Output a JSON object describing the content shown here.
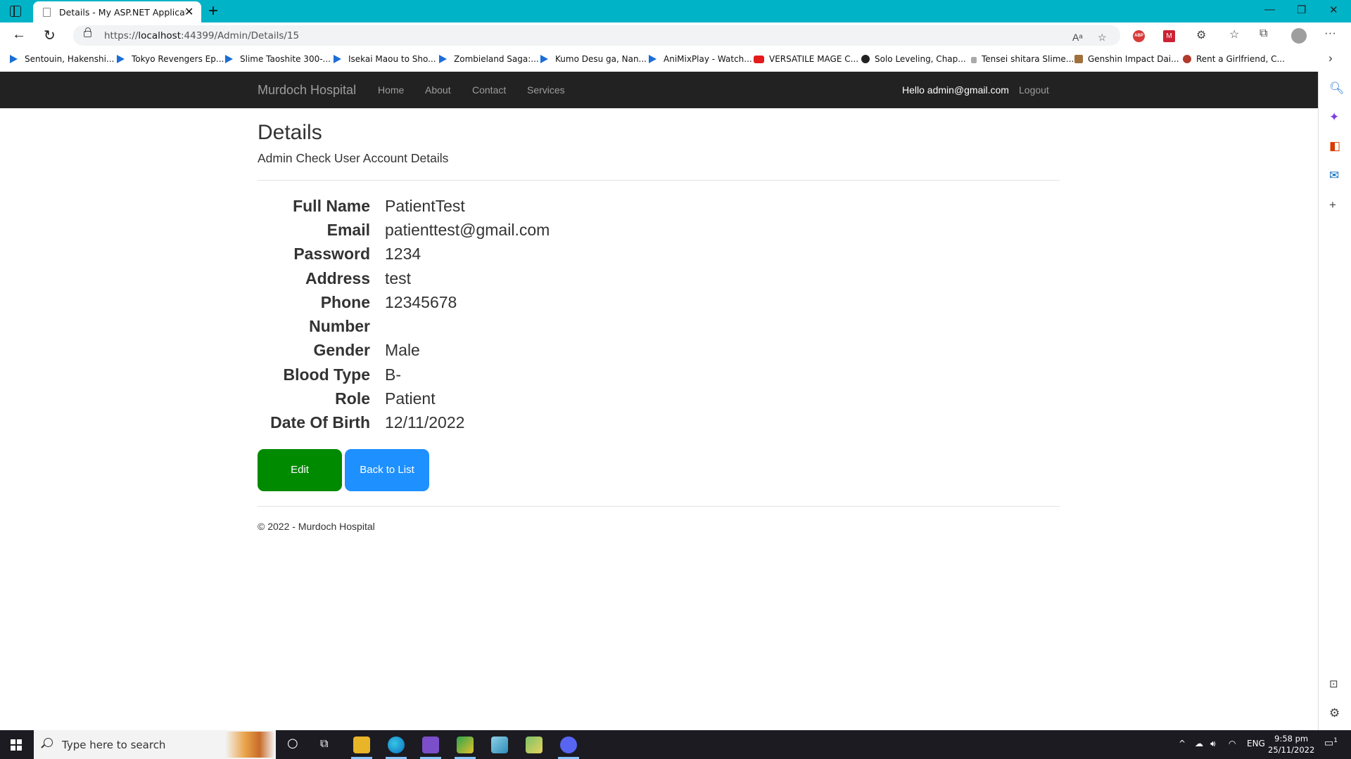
{
  "browser": {
    "tab_title": "Details - My ASP.NET Application",
    "url_prefix": "https://",
    "url_host": "localhost",
    "url_rest": ":44399/Admin/Details/15",
    "bookmarks": [
      {
        "label": "Sentouin, Hakenshi...",
        "icon": "play"
      },
      {
        "label": "Tokyo Revengers Ep...",
        "icon": "play"
      },
      {
        "label": "Slime Taoshite 300-...",
        "icon": "play"
      },
      {
        "label": "Isekai Maou to Sho...",
        "icon": "play"
      },
      {
        "label": "Zombieland Saga:...",
        "icon": "play"
      },
      {
        "label": "Kumo Desu ga, Nan...",
        "icon": "play"
      },
      {
        "label": "AniMixPlay - Watch...",
        "icon": "play"
      },
      {
        "label": "VERSATILE MAGE C...",
        "icon": "youtube"
      },
      {
        "label": "Solo Leveling, Chap...",
        "icon": "dark"
      },
      {
        "label": "Tensei shitara Slime...",
        "icon": "lock"
      },
      {
        "label": "Genshin Impact Dai...",
        "icon": "image"
      },
      {
        "label": "Rent a Girlfriend, C...",
        "icon": "image"
      }
    ]
  },
  "navbar": {
    "brand": "Murdoch Hospital",
    "links": [
      "Home",
      "About",
      "Contact",
      "Services"
    ],
    "greeting": "Hello admin@gmail.com",
    "logout": "Logout"
  },
  "page": {
    "title": "Details",
    "subtitle": "Admin Check User Account Details",
    "details": [
      {
        "label": "Full Name",
        "value": "PatientTest"
      },
      {
        "label": "Email",
        "value": "patienttest@gmail.com"
      },
      {
        "label": "Password",
        "value": "1234"
      },
      {
        "label": "Address",
        "value": "test"
      },
      {
        "label": "Phone",
        "value": "12345678"
      },
      {
        "label": "Number",
        "value": ""
      },
      {
        "label": "Gender",
        "value": "Male"
      },
      {
        "label": "Blood Type",
        "value": "B-"
      },
      {
        "label": "Role",
        "value": "Patient"
      },
      {
        "label": "Date Of Birth",
        "value": "12/11/2022"
      }
    ],
    "edit_label": "Edit",
    "back_label": "Back to List",
    "footer": "© 2022 - Murdoch Hospital"
  },
  "taskbar": {
    "search_placeholder": "Type here to search",
    "language": "ENG",
    "time": "9:58 pm",
    "date": "25/11/2022",
    "notification_count": "1"
  },
  "colors": {
    "edit_button": "#008a00",
    "back_button": "#1e90ff",
    "navbar_bg": "#222222",
    "titlebar": "#00b3c7"
  }
}
